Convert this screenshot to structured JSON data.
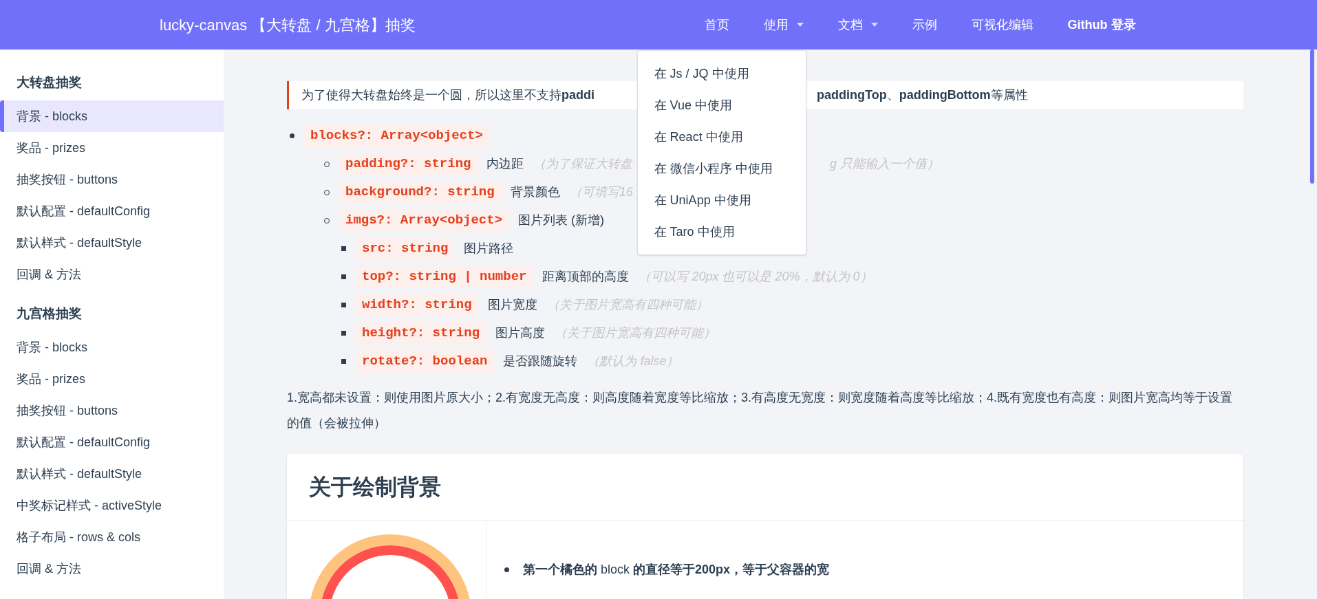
{
  "header": {
    "title": "lucky-canvas 【大转盘 / 九宫格】抽奖",
    "nav": [
      {
        "label": "首页",
        "kind": "link"
      },
      {
        "label": "使用",
        "kind": "dropdown",
        "menu": [
          "在 Js / JQ 中使用",
          "在 Vue 中使用",
          "在 React 中使用",
          "在 微信小程序 中使用",
          "在 UniApp 中使用",
          "在 Taro 中使用"
        ]
      },
      {
        "label": "文档",
        "kind": "dropdown"
      },
      {
        "label": "示例",
        "kind": "link"
      },
      {
        "label": "可视化编辑",
        "kind": "link"
      },
      {
        "label": "Github 登录",
        "kind": "login"
      }
    ]
  },
  "sidebar": [
    {
      "heading": "大转盘抽奖",
      "items": [
        {
          "label": "背景 - blocks",
          "selected": true
        },
        {
          "label": "奖品 - prizes",
          "selected": false
        },
        {
          "label": "抽奖按钮 - buttons",
          "selected": false
        },
        {
          "label": "默认配置 - defaultConfig",
          "selected": false
        },
        {
          "label": "默认样式 - defaultStyle",
          "selected": false
        },
        {
          "label": "回调 & 方法",
          "selected": false
        }
      ]
    },
    {
      "heading": "九宫格抽奖",
      "items": [
        {
          "label": "背景 - blocks",
          "selected": false
        },
        {
          "label": "奖品 - prizes",
          "selected": false
        },
        {
          "label": "抽奖按钮 - buttons",
          "selected": false
        },
        {
          "label": "默认配置 - defaultConfig",
          "selected": false
        },
        {
          "label": "默认样式 - defaultStyle",
          "selected": false
        },
        {
          "label": "中奖标记样式 - activeStyle",
          "selected": false
        },
        {
          "label": "格子布局 - rows & cols",
          "selected": false
        },
        {
          "label": "回调 & 方法",
          "selected": false
        }
      ]
    }
  ],
  "tip": {
    "before": "为了使得大转盘始终是一个圆，所以这里不支持**paddi**",
    "after": "**paddingTop**、**paddingBottom**等属性"
  },
  "props": [
    {
      "code": "blocks?: Array<object>",
      "children": [
        {
          "code": "padding?: string",
          "desc": "内边距",
          "note": "（为了保证大转盘",
          "note_tail": "g 只能输入一个值）"
        },
        {
          "code": "background?: string",
          "desc": "背景颜色",
          "note": "（可填写16"
        },
        {
          "code": "imgs?: Array<object>",
          "desc": "图片列表 (新增)",
          "children": [
            {
              "code": "src: string",
              "desc": "图片路径"
            },
            {
              "code": "top?: string | number",
              "desc": "距离顶部的高度",
              "note": "（可以写 20px 也可以是 20%，默认为 0）"
            },
            {
              "code": "width?: string",
              "desc": "图片宽度",
              "note": "（关于图片宽高有四种可能）"
            },
            {
              "code": "height?: string",
              "desc": "图片高度",
              "note": "（关于图片宽高有四种可能）"
            },
            {
              "code": "rotate?: boolean",
              "desc": "是否跟随旋转",
              "note": "（默认为 false）"
            }
          ]
        }
      ]
    }
  ],
  "paragraph": "1.宽高都未设置：则使用图片原大小；2.有宽度无高度：则高度随着宽度等比缩放；3.有高度无宽度：则宽度随着高度等比缩放；4.既有宽度也有高度：则图片宽高均等于设置的值（会被拉伸）",
  "card": {
    "title": "关于绘制背景",
    "bullets": [
      "**第一个橘色的** block **的直径等于200px，等于父容器的宽**"
    ]
  }
}
